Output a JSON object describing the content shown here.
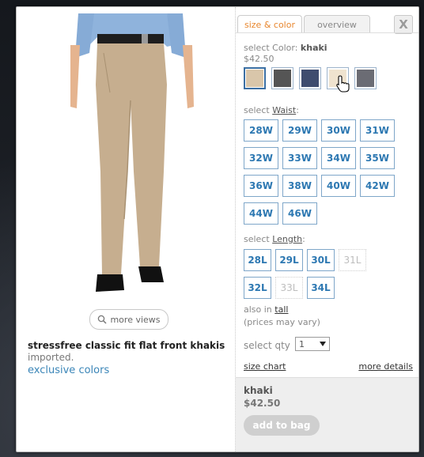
{
  "tabs": {
    "size_color": "size & color",
    "overview": "overview"
  },
  "close_label": "X",
  "product": {
    "name": "stressfree classic fit flat front khakis",
    "subtitle": "imported.",
    "link": "exclusive colors",
    "more_views": "more views"
  },
  "color": {
    "label": "select Color:",
    "selected": "khaki",
    "price": "$42.50",
    "swatches": [
      {
        "name": "khaki",
        "hex": "#d9c6aa"
      },
      {
        "name": "charcoal",
        "hex": "#555555"
      },
      {
        "name": "navy",
        "hex": "#3f4c6e"
      },
      {
        "name": "stone",
        "hex": "#efe3cf"
      },
      {
        "name": "grey",
        "hex": "#6b6c74"
      }
    ]
  },
  "waist": {
    "label_prefix": "select",
    "label_word": "Waist",
    "label_suffix": ":",
    "sizes": [
      "28W",
      "29W",
      "30W",
      "31W",
      "32W",
      "33W",
      "34W",
      "35W",
      "36W",
      "38W",
      "40W",
      "42W",
      "44W",
      "46W"
    ]
  },
  "length": {
    "label_prefix": "select",
    "label_word": "Length",
    "label_suffix": ":",
    "sizes": [
      {
        "label": "28L",
        "available": true
      },
      {
        "label": "29L",
        "available": true
      },
      {
        "label": "30L",
        "available": true
      },
      {
        "label": "31L",
        "available": false
      },
      {
        "label": "32L",
        "available": true
      },
      {
        "label": "33L",
        "available": false
      },
      {
        "label": "34L",
        "available": true
      }
    ]
  },
  "also_in": {
    "prefix": "also in",
    "link": "tall",
    "note": "(prices may vary)"
  },
  "qty": {
    "label": "select qty",
    "value": "1"
  },
  "links": {
    "size_chart": "size chart",
    "more_details": "more details"
  },
  "bag": {
    "name": "khaki",
    "price": "$42.50",
    "button": "add to bag"
  },
  "colors": {
    "accent": "#e8862d",
    "link": "#3b86b8",
    "size_text": "#2d78b2"
  }
}
